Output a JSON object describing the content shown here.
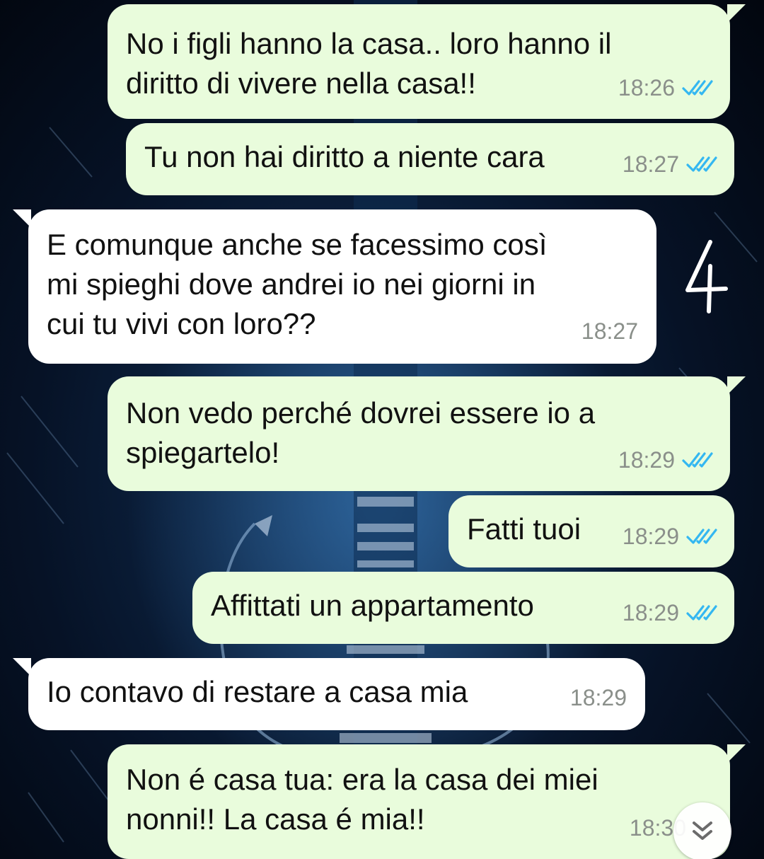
{
  "conversation": {
    "messages": [
      {
        "direction": "outgoing",
        "text": "No i figli hanno la casa.. loro hanno il\ndiritto di vivere nella casa!!",
        "time": "18:26",
        "status": "read"
      },
      {
        "direction": "outgoing",
        "text": "Tu non hai diritto a niente cara",
        "time": "18:27",
        "status": "read"
      },
      {
        "direction": "incoming",
        "text": "E comunque anche se facessimo così\nmi spieghi dove andrei io nei giorni in\ncui tu vivi con loro??",
        "time": "18:27"
      },
      {
        "direction": "outgoing",
        "text": "Non vedo perché dovrei essere io a\nspiegartelo!",
        "time": "18:29",
        "status": "read"
      },
      {
        "direction": "outgoing",
        "text": "Fatti tuoi",
        "time": "18:29",
        "status": "read"
      },
      {
        "direction": "outgoing",
        "text": "Affittati un appartamento",
        "time": "18:29",
        "status": "read"
      },
      {
        "direction": "incoming",
        "text": "Io contavo di restare a casa mia",
        "time": "18:29"
      },
      {
        "direction": "outgoing",
        "text": "Non é casa tua: era la casa dei miei\nnonni!! La casa é mia!!",
        "time": "18:30",
        "status": "read"
      }
    ]
  },
  "annotation": {
    "text": "4"
  },
  "colors": {
    "outgoing_bubble": "#e9fcdc",
    "incoming_bubble": "#ffffff",
    "read_ticks": "#34b7f1",
    "timestamp": "#8a8f8a",
    "wallpaper": "#0c2240"
  },
  "icons": {
    "read_receipt": "double-check-icon",
    "scroll_down": "double-chevron-down-icon"
  }
}
